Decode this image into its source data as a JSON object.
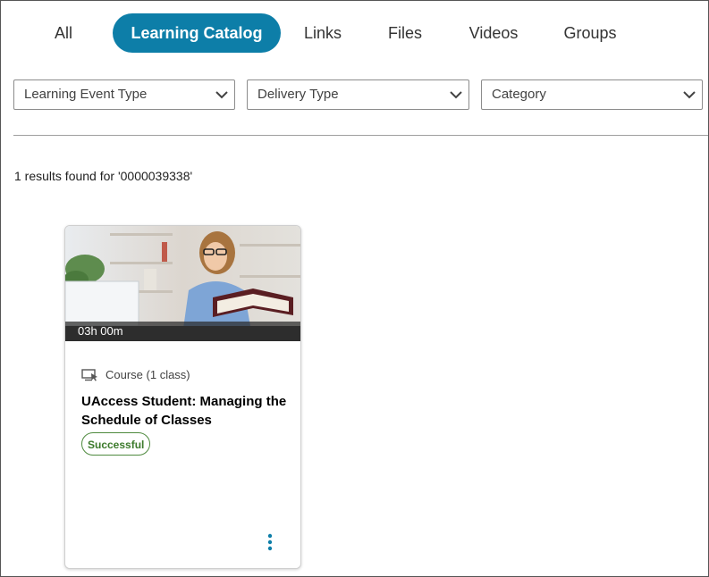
{
  "tabs": [
    {
      "label": "All"
    },
    {
      "label": "Learning Catalog",
      "active": true
    },
    {
      "label": "Links"
    },
    {
      "label": "Files"
    },
    {
      "label": "Videos"
    },
    {
      "label": "Groups"
    }
  ],
  "filters": [
    {
      "label": "Learning Event Type",
      "icon": "chevron-down-icon"
    },
    {
      "label": "Delivery Type",
      "icon": "chevron-down-icon"
    },
    {
      "label": "Category",
      "icon": "chevron-down-icon"
    }
  ],
  "results": {
    "text": "1 results found for '0000039338'"
  },
  "card": {
    "duration": "03h 00m",
    "type_icon": "course-screen-icon",
    "type": "Course (1 class)",
    "title": "UAccess Student: Managing the Schedule of Classes",
    "status": "Successful",
    "menu_icon": "more-vertical-icon"
  },
  "colors": {
    "accent": "#0d7ea8",
    "status_green": "#3c7a2b"
  }
}
